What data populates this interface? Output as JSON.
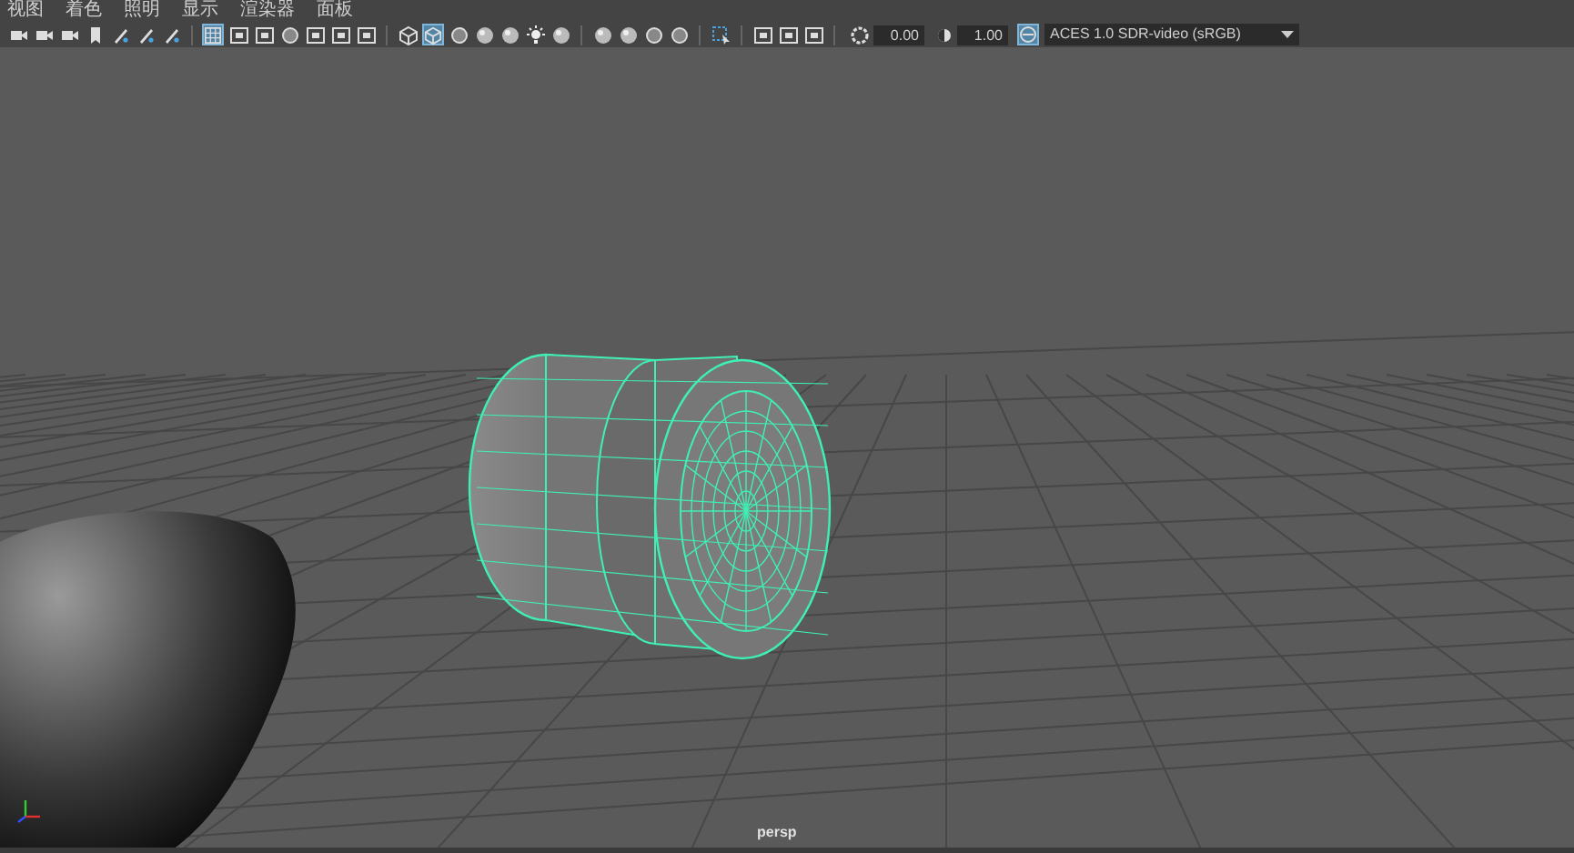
{
  "menu_bar": {
    "items": [
      "视图",
      "着色",
      "照明",
      "显示",
      "渲染器",
      "面板"
    ]
  },
  "toolbar": {
    "groups": [
      [
        {
          "kind": "camera",
          "selected": false
        },
        {
          "kind": "camera",
          "selected": false
        },
        {
          "kind": "camera",
          "selected": false
        },
        {
          "kind": "bookmark",
          "selected": false
        },
        {
          "kind": "pen",
          "selected": false
        },
        {
          "kind": "pen",
          "selected": false
        },
        {
          "kind": "pen",
          "selected": false
        }
      ],
      [
        {
          "kind": "grid",
          "selected": true
        },
        {
          "kind": "frame",
          "selected": false
        },
        {
          "kind": "frame",
          "selected": false
        },
        {
          "kind": "circle",
          "selected": false
        },
        {
          "kind": "frame",
          "selected": false
        },
        {
          "kind": "frame",
          "selected": false
        },
        {
          "kind": "frame",
          "selected": false
        }
      ],
      [
        {
          "kind": "cube",
          "selected": false
        },
        {
          "kind": "cube",
          "selected": true
        },
        {
          "kind": "circle",
          "selected": false
        },
        {
          "kind": "sphere",
          "selected": false
        },
        {
          "kind": "sphere",
          "selected": false
        },
        {
          "kind": "light",
          "selected": false
        },
        {
          "kind": "sphere",
          "selected": false
        }
      ],
      [
        {
          "kind": "sphere",
          "selected": false
        },
        {
          "kind": "sphere",
          "selected": false
        },
        {
          "kind": "circle",
          "selected": false
        },
        {
          "kind": "circle",
          "selected": false
        }
      ],
      [
        {
          "kind": "select",
          "selected": false
        }
      ],
      [
        {
          "kind": "frame",
          "selected": false
        },
        {
          "kind": "frame",
          "selected": false
        },
        {
          "kind": "frame",
          "selected": false
        }
      ]
    ],
    "exposure": "0.00",
    "gamma": "1.00",
    "color_management_on": true,
    "view_transform": "ACES 1.0 SDR-video (sRGB)"
  },
  "viewport": {
    "camera_label": "persp"
  }
}
